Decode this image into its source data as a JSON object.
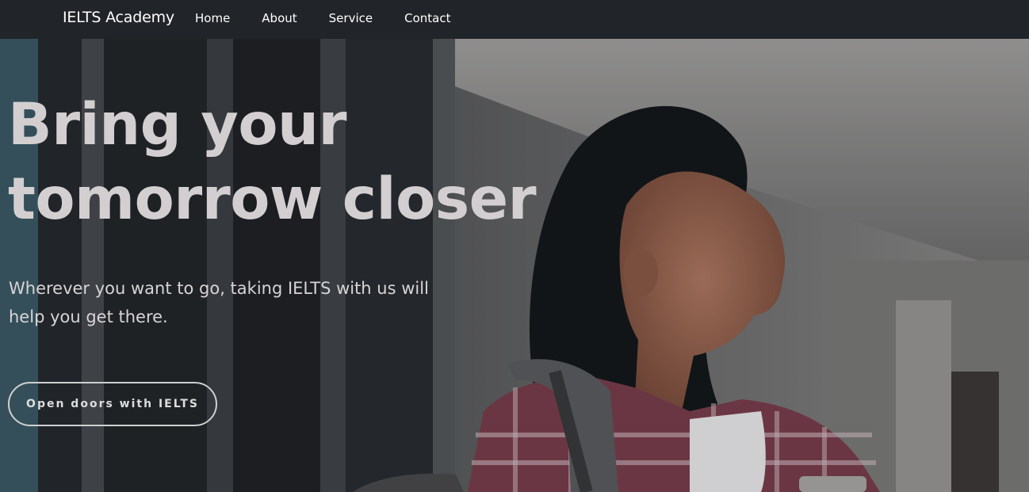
{
  "navbar": {
    "brand": "IELTS Academy",
    "links": [
      "Home",
      "About",
      "Service",
      "Contact"
    ]
  },
  "hero": {
    "title": "Bring your tomorrow closer",
    "subtitle": "Wherever you want to go, taking IELTS with us will help you get there.",
    "cta_label": "Open doors with IELTS"
  },
  "colors": {
    "navbar_bg": "#212529",
    "hero_text": "#d3cfd1",
    "button_border": "#cfcfcf"
  }
}
